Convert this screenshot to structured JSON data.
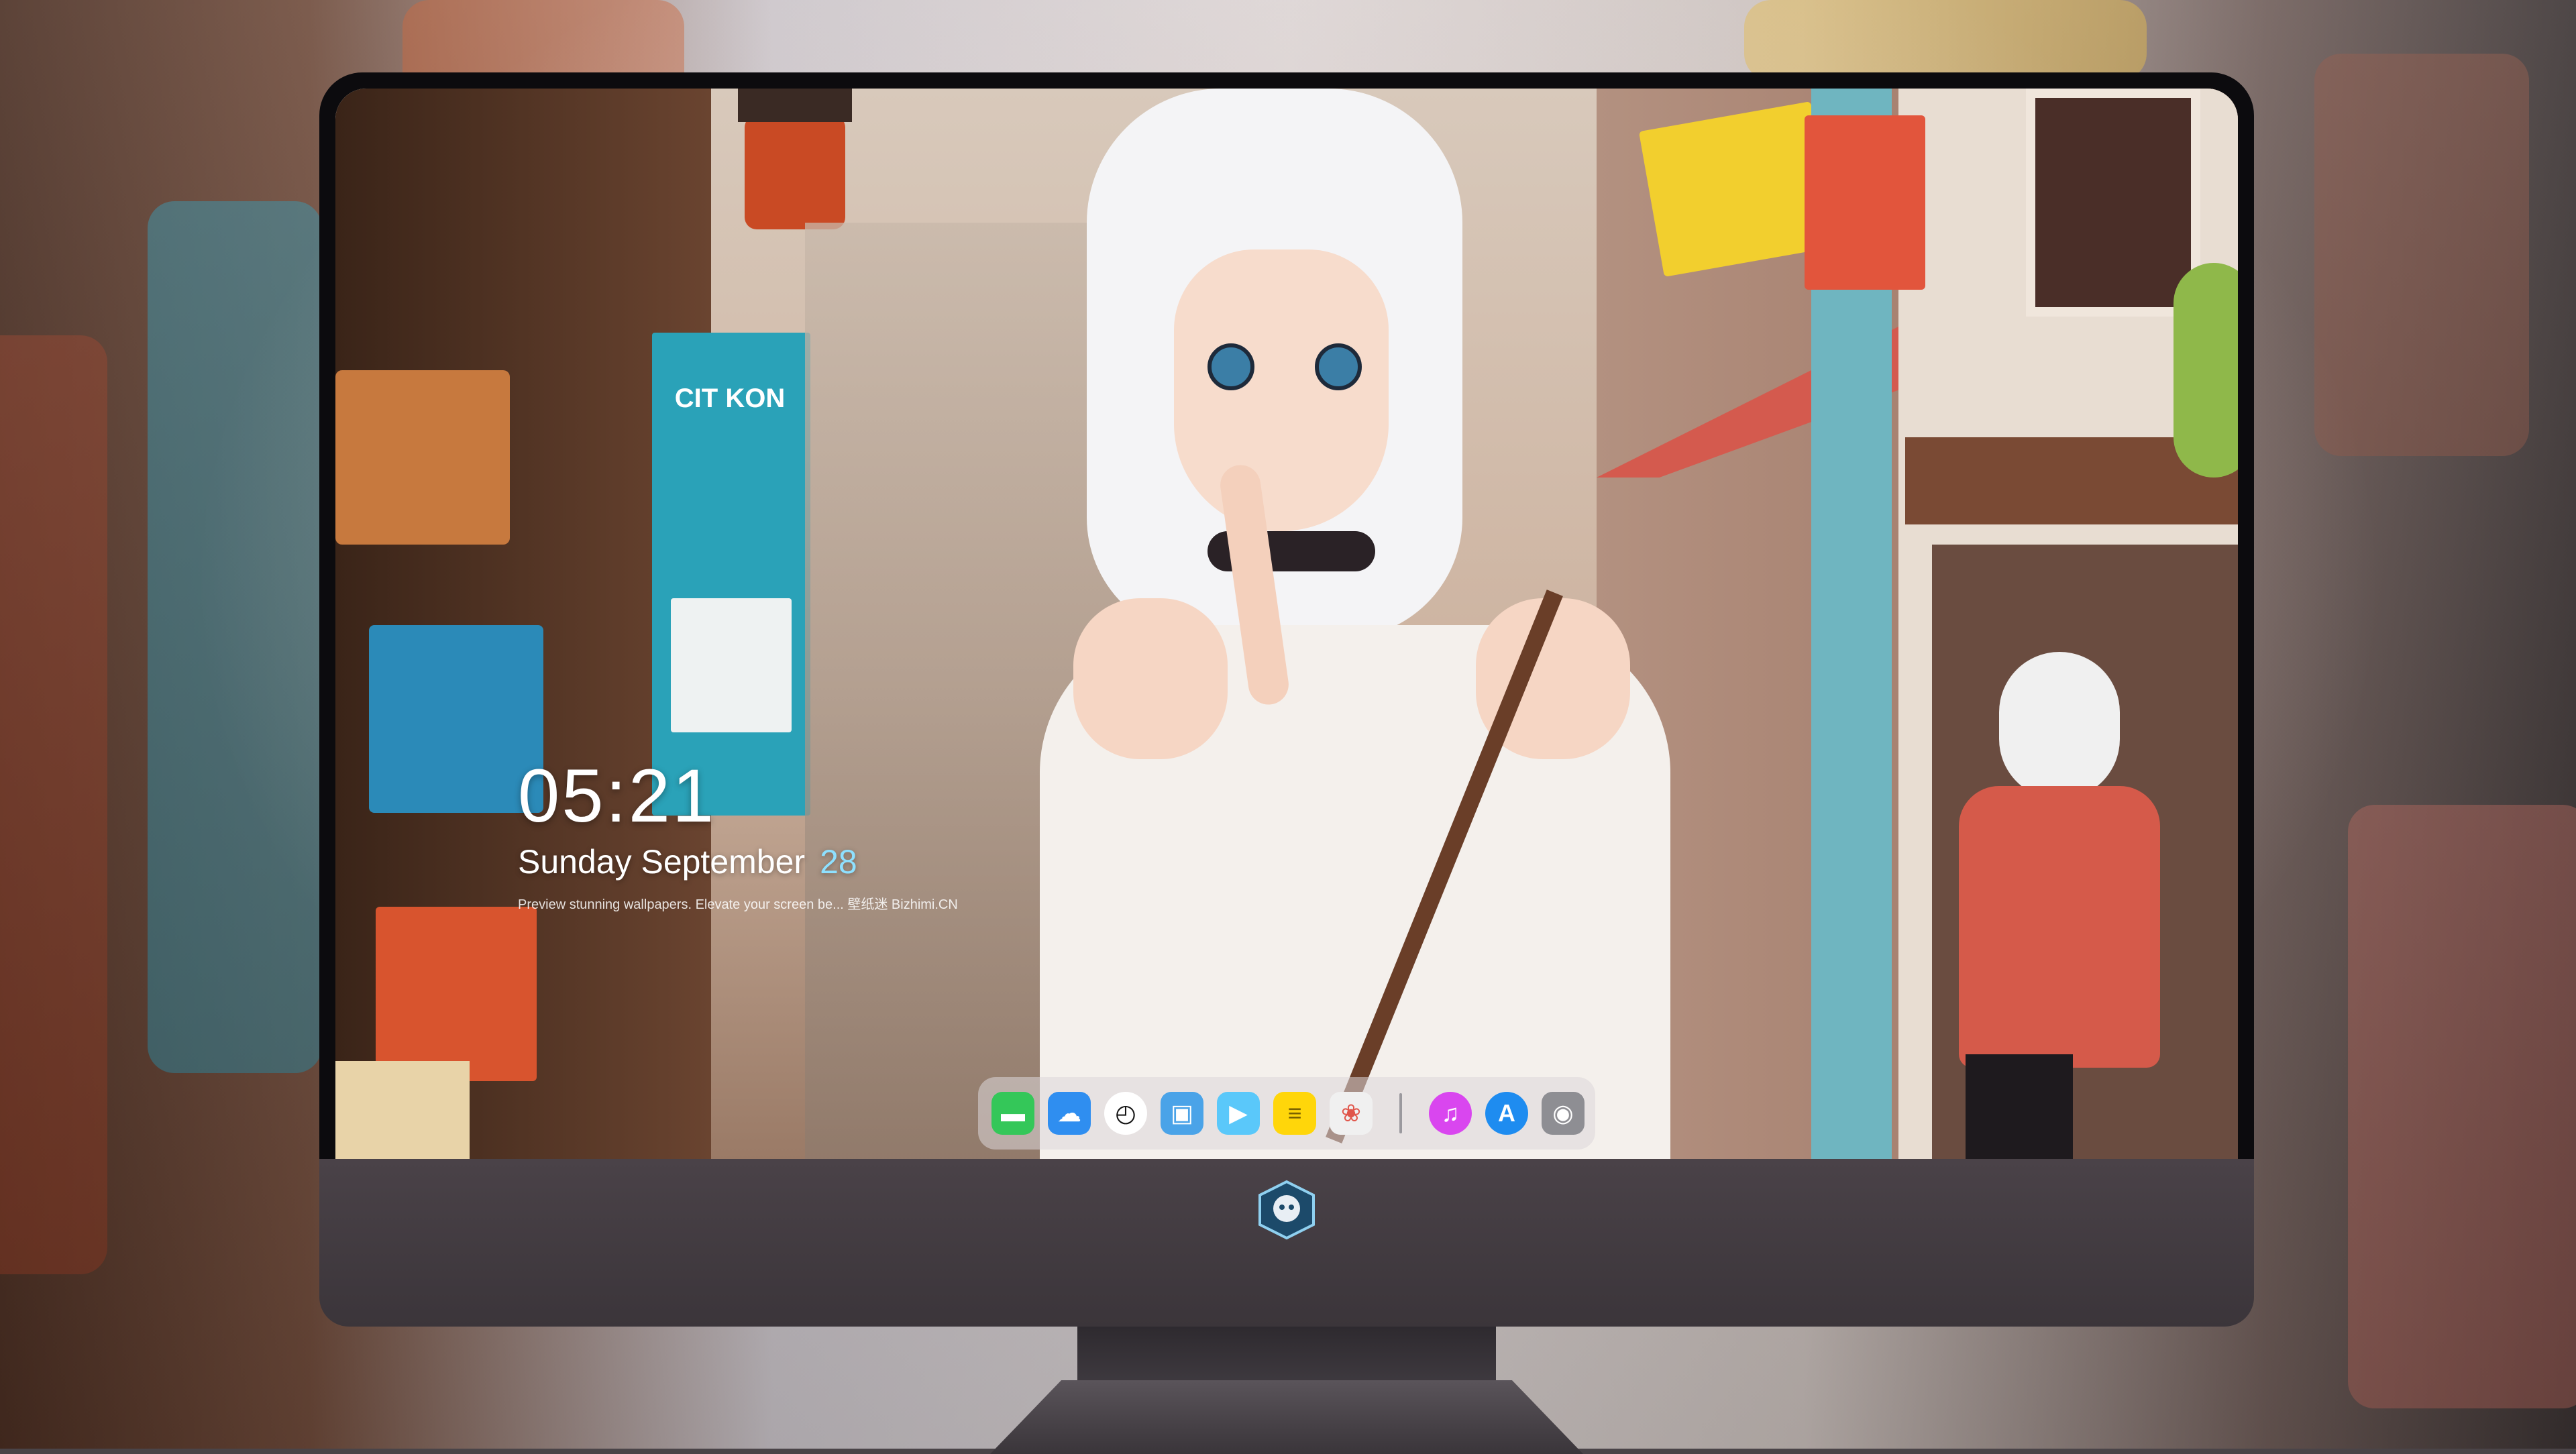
{
  "lock_screen": {
    "time": "05:21",
    "date_text": "Sunday September",
    "day_number": "28",
    "caption": "Preview stunning wallpapers. Elevate your screen be...  壁纸迷 Bizhimi.CN"
  },
  "wallpaper": {
    "sign_text": "CIT KON"
  },
  "dock": {
    "apps": [
      {
        "name": "Messages",
        "icon": "message-icon",
        "color": "#34c759",
        "glyph": "▬"
      },
      {
        "name": "Weather",
        "icon": "weather-icon",
        "color": "#2f8ef0",
        "glyph": "☁"
      },
      {
        "name": "Clock",
        "icon": "clock-icon",
        "color": "#ffffff",
        "glyph": "◴"
      },
      {
        "name": "Preview",
        "icon": "preview-icon",
        "color": "#4aa3e8",
        "glyph": "▣"
      },
      {
        "name": "Clips",
        "icon": "clips-icon",
        "color": "#5ac8fa",
        "glyph": "▶"
      },
      {
        "name": "Notes",
        "icon": "notes-icon",
        "color": "#ffd60a",
        "glyph": "≡"
      },
      {
        "name": "Photos",
        "icon": "photos-icon",
        "color": "#f0f0f0",
        "glyph": "❀"
      },
      {
        "name": "Music",
        "icon": "music-icon",
        "color": "#d946ef",
        "glyph": "♫"
      },
      {
        "name": "App Store",
        "icon": "app-store-icon",
        "color": "#1e8cf0",
        "glyph": "A"
      },
      {
        "name": "Camera",
        "icon": "camera-icon",
        "color": "#8e8e93",
        "glyph": "◉"
      }
    ]
  },
  "colors": {
    "accent_day": "#8ee0ff",
    "bezel": "#0c0b0e",
    "chin": "#4a4248"
  }
}
